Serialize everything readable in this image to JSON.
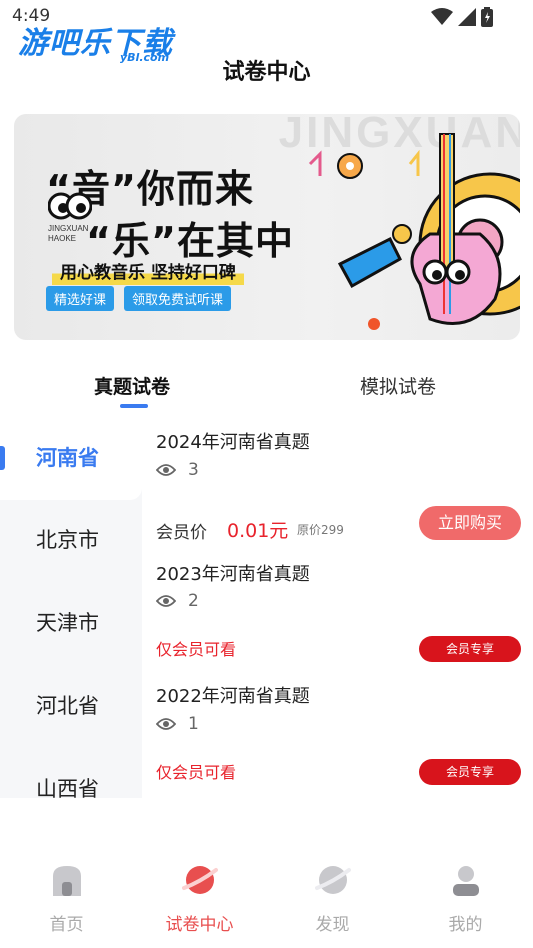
{
  "status_bar": {
    "time": "4:49"
  },
  "watermark": {
    "text": "游吧乐下载",
    "sub": "yBl.com"
  },
  "header": {
    "title": "试卷中心"
  },
  "banner": {
    "bg_text": "JINGXUAN",
    "line1": "“音”你而来",
    "line2": "“乐”在其中",
    "brand_line1": "JINGXUAN",
    "brand_line2": "HAOKE",
    "slogan": "用心教音乐 坚持好口碑",
    "tags": [
      "精选好课",
      "领取免费试听课"
    ]
  },
  "tabs": [
    {
      "label": "真题试卷",
      "active": true
    },
    {
      "label": "模拟试卷",
      "active": false
    }
  ],
  "provinces": [
    {
      "label": "河南省",
      "active": true
    },
    {
      "label": "北京市",
      "active": false
    },
    {
      "label": "天津市",
      "active": false
    },
    {
      "label": "河北省",
      "active": false
    },
    {
      "label": "山西省",
      "active": false
    }
  ],
  "exams": [
    {
      "title": "2024年河南省真题",
      "views": "3"
    },
    {
      "title": "2023年河南省真题",
      "views": "2"
    },
    {
      "title": "2022年河南省真题",
      "views": "1"
    }
  ],
  "purchase": {
    "member_label": "会员价",
    "member_price": "0.01元",
    "original_price": "原价299",
    "buy_label": "立即购买"
  },
  "member_only": {
    "notice": "仅会员可看",
    "exclusive_label": "会员专享"
  },
  "bottom_nav": [
    {
      "label": "首页",
      "icon": "home-icon",
      "active": false
    },
    {
      "label": "试卷中心",
      "icon": "planet-icon",
      "active": true
    },
    {
      "label": "发现",
      "icon": "discover-icon",
      "active": false
    },
    {
      "label": "我的",
      "icon": "profile-icon",
      "active": false
    }
  ],
  "colors": {
    "accent_blue": "#3a7bf0",
    "price_red": "#e8232c",
    "buy_button": "#f06a6a",
    "exclusive_button": "#d8141c",
    "nav_active": "#e84f4f"
  }
}
